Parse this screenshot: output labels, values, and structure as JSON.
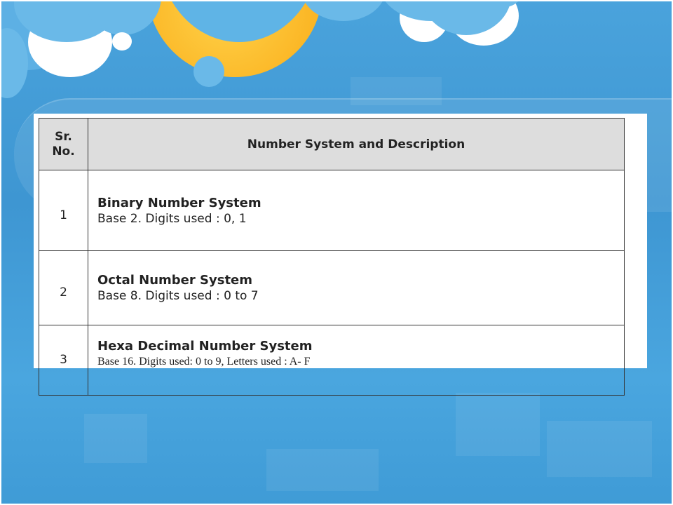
{
  "table": {
    "header": {
      "sr_line1": "Sr.",
      "sr_line2": "No.",
      "description": "Number System and Description"
    },
    "rows": [
      {
        "sr": "1",
        "name": "Binary Number System",
        "desc": "Base 2. Digits used : 0, 1"
      },
      {
        "sr": "2",
        "name": "Octal Number System",
        "desc": "Base 8. Digits used : 0 to 7"
      },
      {
        "sr": "3",
        "name": "Hexa Decimal Number System",
        "desc": "Base 16. Digits used: 0 to 9, Letters used : A- F"
      }
    ]
  },
  "colors": {
    "background": "#4a9fd6",
    "header_fill": "#dddddd",
    "moon": "#fbb726",
    "cloud": "#ffffff"
  }
}
